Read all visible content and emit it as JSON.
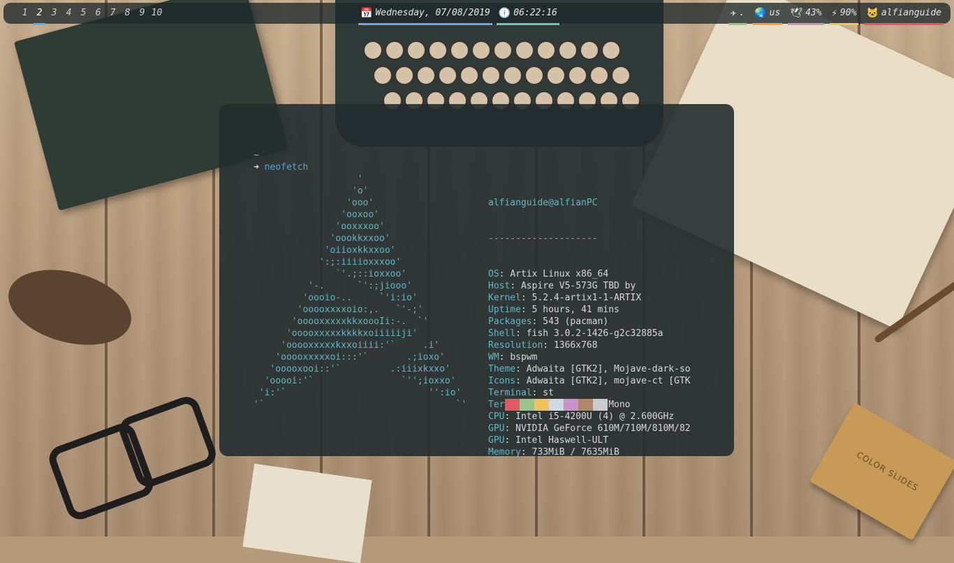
{
  "workspaces": [
    {
      "label": "1"
    },
    {
      "label": "2",
      "active": true
    },
    {
      "label": "3"
    },
    {
      "label": "4"
    },
    {
      "label": "5"
    },
    {
      "label": "6"
    },
    {
      "label": "7"
    },
    {
      "label": "8"
    },
    {
      "label": "9"
    },
    {
      "label": "10"
    }
  ],
  "clock": {
    "date": "Wednesday, 07/08/2019",
    "time": "06:22:16"
  },
  "status": {
    "dot": ".",
    "keyboard": "us",
    "volume": "43%",
    "battery": "90%",
    "user": "alfianguide"
  },
  "terminal": {
    "tilde": "~",
    "arrow": "➜",
    "command": "neofetch",
    "ascii": "                   '\n                  'o'\n                 'ooo'\n                'ooxoo'\n               'ooxxxoo'\n              'oookkxxoo'\n             'oiioxkkxxoo'\n            ':;:iiiioxxxoo'\n               `'.;::ioxxoo'\n          '-.      `':;jiooo'\n         'oooio-..     `'i:io'\n        'ooooxxxxoio:,.   `'-;'\n       'ooooxxxxxkkxoooIi:-.  `'\n      'ooooxxxxxkkkkxoiiiiiji'\n     'ooooxxxxxkxxoiiii:'`     .i'\n    'ooooxxxxxoi:::'`       .;ioxo'\n   'ooooxooi::'`         .:iiixkxxo'\n  'ooooi:'`                `'';ioxxo'\n 'i:'`                          '':io'\n'`                                   `'",
    "userhost": "alfianguide@alfianPC",
    "separator": "--------------------",
    "info": [
      {
        "label": "OS",
        "value": "Artix Linux x86_64"
      },
      {
        "label": "Host",
        "value": "Aspire V5-573G TBD by"
      },
      {
        "label": "Kernel",
        "value": "5.2.4-artix1-1-ARTIX"
      },
      {
        "label": "Uptime",
        "value": "5 hours, 41 mins"
      },
      {
        "label": "Packages",
        "value": "543 (pacman)"
      },
      {
        "label": "Shell",
        "value": "fish 3.0.2-1426-g2c32885a"
      },
      {
        "label": "Resolution",
        "value": "1366x768"
      },
      {
        "label": "WM",
        "value": "bspwm"
      },
      {
        "label": "Theme",
        "value": "Adwaita [GTK2], Mojave-dark-so"
      },
      {
        "label": "Icons",
        "value": "Adwaita [GTK2], mojave-ct [GTK"
      },
      {
        "label": "Terminal",
        "value": "st"
      },
      {
        "label": "Terminal Font",
        "value": "Victor Mono"
      },
      {
        "label": "CPU",
        "value": "Intel i5-4200U (4) @ 2.600GHz"
      },
      {
        "label": "GPU",
        "value": "NVIDIA GeForce 610M/710M/810M/82"
      },
      {
        "label": "GPU",
        "value": "Intel Haswell-ULT"
      },
      {
        "label": "Memory",
        "value": "733MiB / 7635MiB"
      }
    ],
    "palette": [
      "#e05a66",
      "#9bc48a",
      "#f3c15e",
      "#cfd8e3",
      "#c993c9",
      "#b38568",
      "#c9cbd0"
    ]
  },
  "wallpaper": {
    "slides_label": "COLOR SLIDES"
  }
}
